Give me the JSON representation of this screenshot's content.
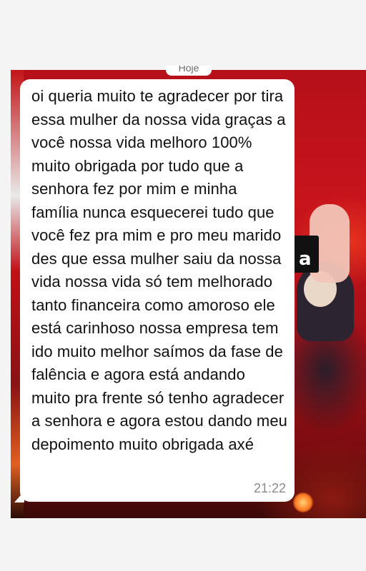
{
  "chat": {
    "date_divider": "Hoje",
    "message": {
      "text": "oi queria muito te agradecer por tira essa mulher da nossa vida graças a você nossa vida melhoro 100% muito obrigada por tudo que a senhora fez por mim e minha família nunca esquecerei tudo que você fez pra mim e pro meu marido des que essa mulher saiu da nossa vida nossa vida só tem melhorado tanto financeira como amoroso ele está carinhoso nossa empresa tem ido muito melhor saímos da fase de falência e agora está andando muito pra frente só tenho agradecer a senhora e agora estou dando meu depoimento muito obrigada axé",
      "time": "21:22"
    },
    "background_text": "a"
  },
  "colors": {
    "page_bg": "#f4f4f4",
    "bubble_bg": "#ffffff",
    "message_text": "#111111",
    "timestamp_text": "#8a8a8a",
    "wallpaper_red": "#c8141c"
  }
}
